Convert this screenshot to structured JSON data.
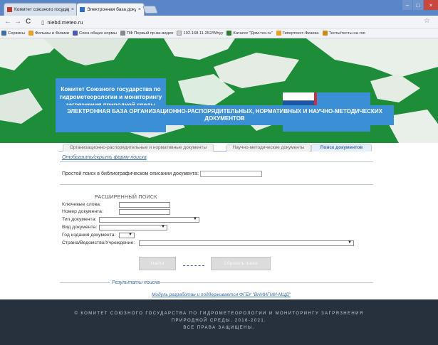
{
  "browser": {
    "tabs": [
      {
        "label": "Комитет союзного государ...",
        "active": false
      },
      {
        "label": "Электронная база докумен...",
        "active": true
      }
    ],
    "url": "niebd.meteo.ru",
    "bookmarks": [
      "Сервисы",
      "Фильмы и Физики",
      "Союз общих нормы",
      "ПФ Первый пр-ва-видео",
      "192.168.11.252/Whyy",
      "Каталог \"Дом-тех.ru\"",
      "Гипертекст-Физика",
      "Тесты/тесты на гоо"
    ]
  },
  "banner": {
    "committee": "Комитет Союзного государства по гидрометеорологии и мониторингу загрязнения природной среды",
    "db_title": "ЭЛЕКТРОННАЯ БАЗА ОРГАНИЗАЦИОННО-РАСПОРЯДИТЕЛЬНЫХ, НОРМАТИВНЫХ И НАУЧНО-МЕТОДИЧЕСКИХ ДОКУМЕНТОВ",
    "colors": {
      "green": "#1e8d3a",
      "blue": "#3b8fd5"
    }
  },
  "page_tabs": [
    {
      "label": "Организационно-распорядительные и нормативные документы",
      "active": false
    },
    {
      "label": "Научно-методические документы",
      "active": false
    },
    {
      "label": "Поиск документов",
      "active": true
    }
  ],
  "search": {
    "toggle_link": "Отобразить/скрыть форму поиска",
    "simple_label": "Простой поиск в библиографическом описании документа:",
    "simple_value": "",
    "advanced_title": "РАСШИРЕННЫЙ ПОИСК",
    "fields": {
      "keywords": "Ключевые слова:",
      "doc_number": "Номер документа:",
      "doc_type": "Тип документа:",
      "doc_kind": "Вид документа:",
      "pub_year": "Год издания документа:",
      "agency": "Страна/Ведомство/Учреждение:"
    },
    "find_button": "Найти",
    "reset_button": "Сбросить поиск",
    "results_label": "Результаты поиска"
  },
  "credit": "Модуль разработан и поддерживается ФГБУ \"ВНИИГМИ-МЦД\"",
  "footer": {
    "line1": "© КОМИТЕТ СОЮЗНОГО ГОСУДАРСТВА ПО ГИДРОМЕТЕОРОЛОГИИ И МОНИТОРИНГУ ЗАГРЯЗНЕНИЯ",
    "line2": "ПРИРОДНОЙ СРЕДЫ, 2016-2021.",
    "line3": "ВСЕ ПРАВА ЗАЩИЩЕНЫ."
  }
}
